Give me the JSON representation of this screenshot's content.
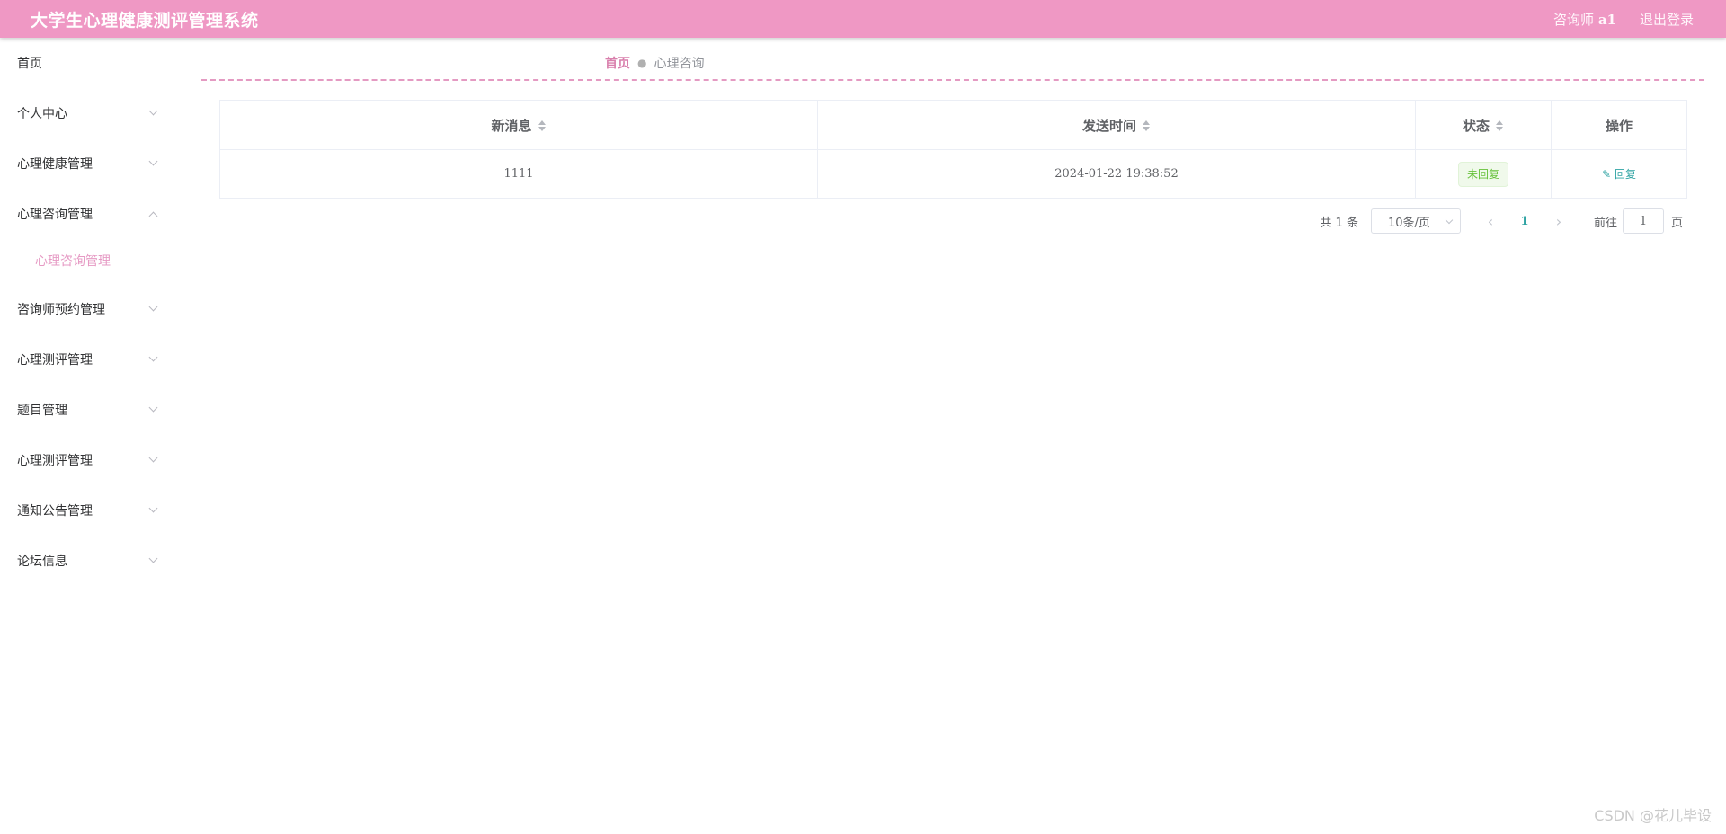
{
  "header": {
    "title": "大学生心理健康测评管理系统",
    "user_role": "咨询师",
    "user_name": "a1",
    "logout": "退出登录"
  },
  "sidebar": {
    "items": [
      {
        "label": "首页",
        "has_arrow": false
      },
      {
        "label": "个人中心",
        "has_arrow": true
      },
      {
        "label": "心理健康管理",
        "has_arrow": true
      },
      {
        "label": "心理咨询管理",
        "has_arrow": true,
        "expanded": true,
        "children": [
          {
            "label": "心理咨询管理",
            "active": true
          }
        ]
      },
      {
        "label": "咨询师预约管理",
        "has_arrow": true
      },
      {
        "label": "心理测评管理",
        "has_arrow": true
      },
      {
        "label": "题目管理",
        "has_arrow": true
      },
      {
        "label": "心理测评管理",
        "has_arrow": true
      },
      {
        "label": "通知公告管理",
        "has_arrow": true
      },
      {
        "label": "论坛信息",
        "has_arrow": true
      }
    ]
  },
  "breadcrumb": {
    "home": "首页",
    "current": "心理咨询"
  },
  "table": {
    "columns": [
      {
        "label": "新消息",
        "sortable": true
      },
      {
        "label": "发送时间",
        "sortable": true
      },
      {
        "label": "状态",
        "sortable": true
      },
      {
        "label": "操作",
        "sortable": false
      }
    ],
    "rows": [
      {
        "message": "1111",
        "time": "2024-01-22 19:38:52",
        "status": "未回复",
        "action": "回复"
      }
    ]
  },
  "pagination": {
    "total_text": "共 1 条",
    "page_size": "10条/页",
    "current_page": "1",
    "goto_label": "前往",
    "goto_value": "1",
    "goto_suffix": "页"
  },
  "watermark": "CSDN @花儿毕设",
  "colors": {
    "header_bg": "#ef98c4",
    "accent_pink": "#e69ac4",
    "accent_teal": "#2fa3a3",
    "status_green": "#67c23a"
  }
}
